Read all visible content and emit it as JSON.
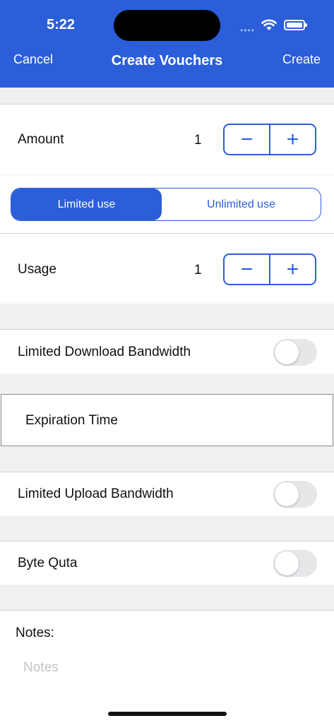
{
  "status_bar": {
    "time": "5:22",
    "signal_dots": "••••"
  },
  "nav": {
    "cancel": "Cancel",
    "title": "Create Vouchers",
    "create": "Create"
  },
  "amount": {
    "label": "Amount",
    "value": "1",
    "minus": "−",
    "plus": "+"
  },
  "usage_mode": {
    "limited": "Limited use",
    "unlimited": "Unlimited use",
    "selected": "Limited use"
  },
  "usage": {
    "label": "Usage",
    "value": "1",
    "minus": "−",
    "plus": "+"
  },
  "download_bandwidth": {
    "label": "Limited Download Bandwidth",
    "enabled": false
  },
  "expiration": {
    "label": "Expiration Time"
  },
  "upload_bandwidth": {
    "label": "Limited Upload Bandwidth",
    "enabled": false
  },
  "byte_quota": {
    "label": "Byte Quta",
    "enabled": false
  },
  "notes": {
    "label": "Notes:",
    "placeholder": "Notes",
    "value": ""
  },
  "colors": {
    "accent": "#2b5ed8",
    "toggle_off": "#e7e7ea",
    "background": "#f0f0f0"
  }
}
